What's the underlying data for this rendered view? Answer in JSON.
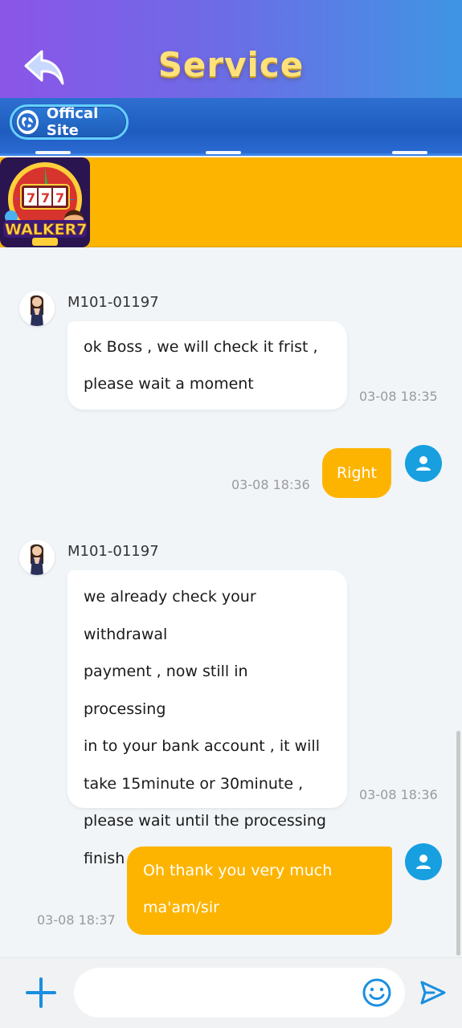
{
  "header": {
    "title": "Service",
    "back_icon": "back-arrow-icon"
  },
  "subbar": {
    "official_label": "Offical Site",
    "globe_icon": "globe-icon"
  },
  "banner": {
    "logo_icon": "walker7-logo",
    "accent_color": "#fdb400"
  },
  "messages": [
    {
      "from": "agent",
      "sender": "M101-01197",
      "lines": [
        "ok Boss , we will check it frist ,",
        "please wait a moment"
      ],
      "time": "03-08 18:35"
    },
    {
      "from": "user",
      "text": "Right",
      "time": "03-08 18:36"
    },
    {
      "from": "agent",
      "sender": "M101-01197",
      "lines": [
        "we already check your withdrawal",
        "payment , now still in processing",
        "in to your bank account , it will",
        "take 15minute or 30minute ,",
        "please wait until the processing",
        "finish . thankyou"
      ],
      "time": "03-08 18:36"
    },
    {
      "from": "user",
      "lines": [
        "Oh thank you very much",
        "ma'am/sir"
      ],
      "time": "03-08 18:37"
    }
  ],
  "input": {
    "placeholder": "",
    "plus_icon": "plus-icon",
    "emoji_icon": "emoji-icon",
    "send_icon": "send-icon"
  }
}
